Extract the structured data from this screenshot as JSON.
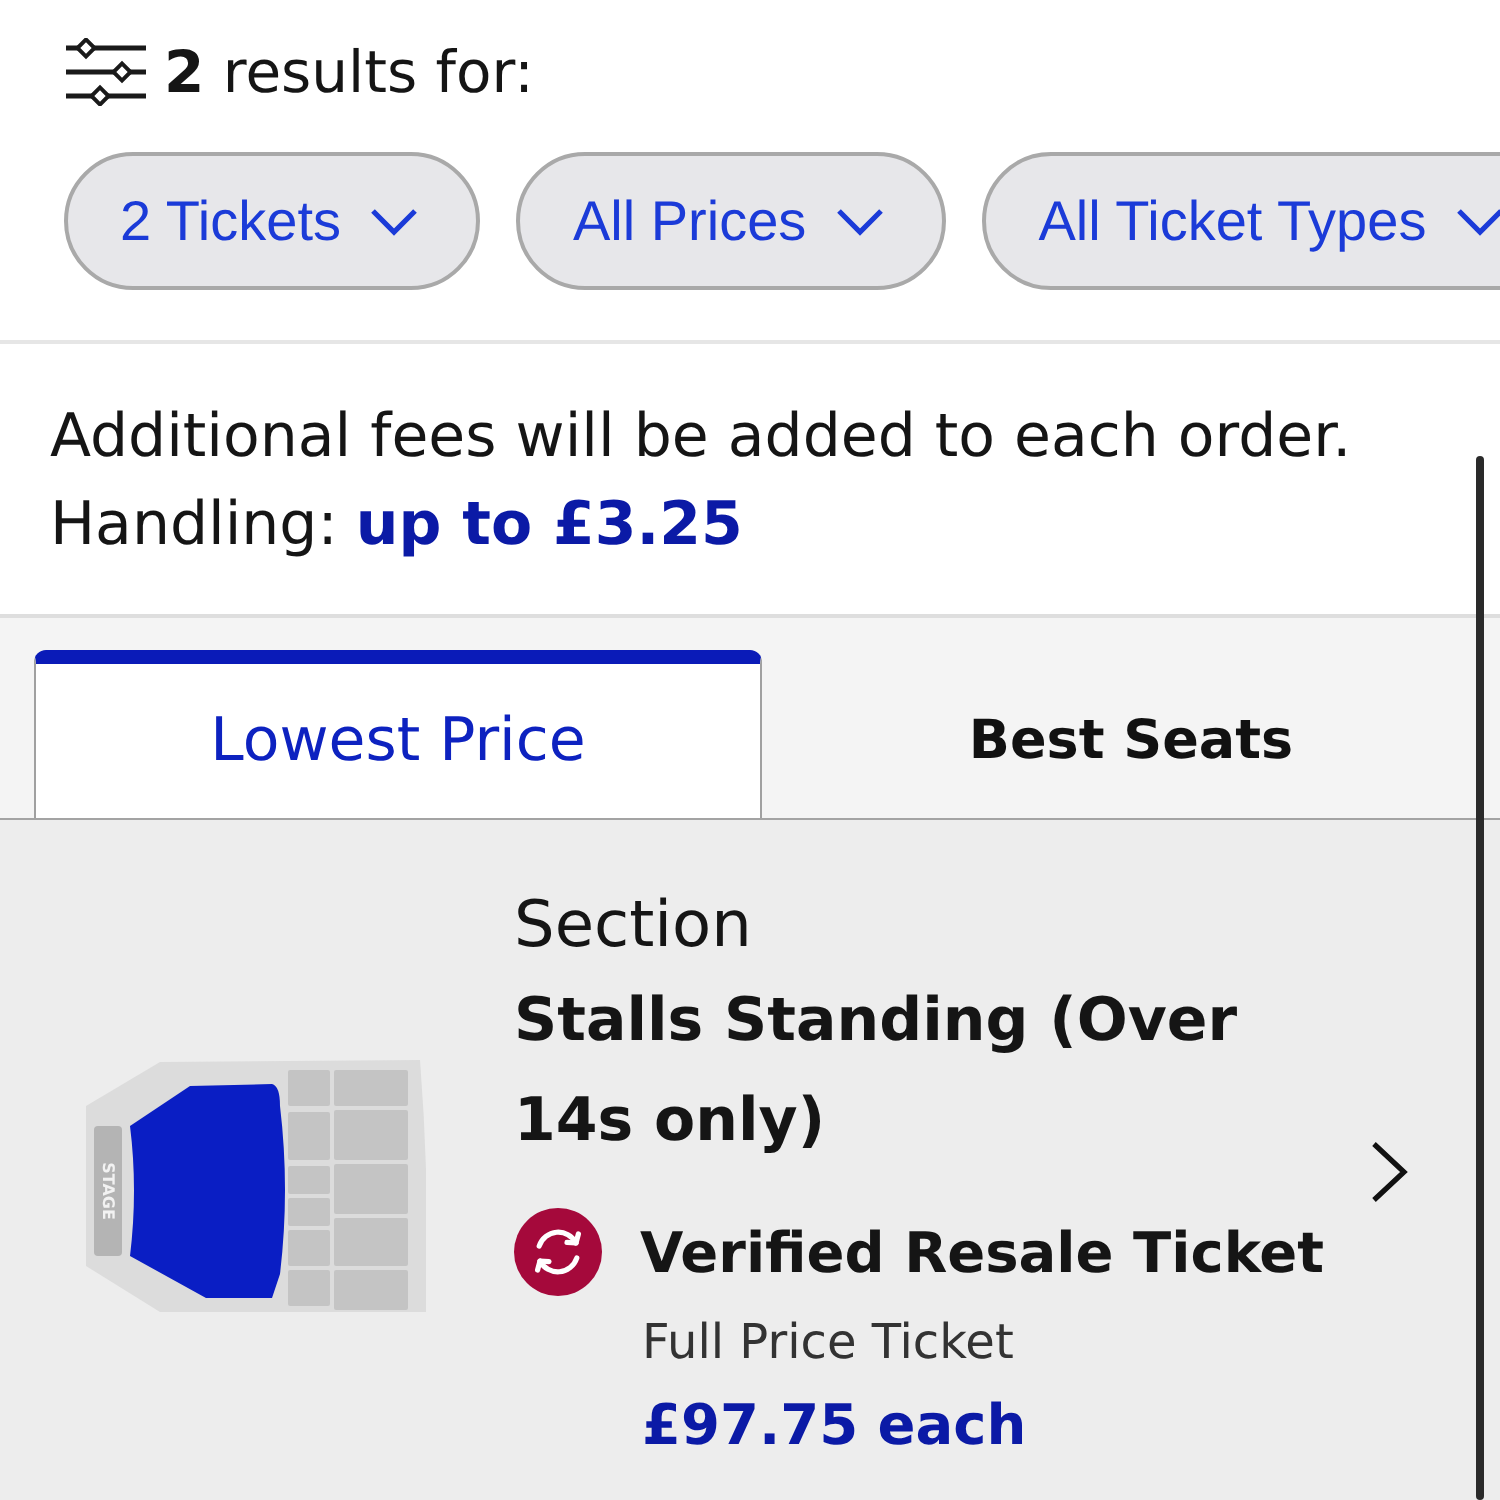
{
  "header": {
    "results_text": "**2** results for:"
  },
  "filters": [
    {
      "label": "2 Tickets"
    },
    {
      "label": "All Prices"
    },
    {
      "label": "All Ticket Types"
    }
  ],
  "fees": {
    "notice": "Additional fees will be added to each order.",
    "handling_label": "Handling:",
    "handling_link": "up to £3.25"
  },
  "sort_tabs": [
    {
      "label": "Lowest Price",
      "selected": true
    },
    {
      "label": "Best Seats",
      "selected": false
    }
  ],
  "listing": {
    "seat_map": {
      "stage_label": "STAGE"
    },
    "section_label": "Section",
    "section_name": "Stalls Standing (Over 14s only)",
    "ticket_type": "Verified Resale Ticket",
    "price_type": "Full Price Ticket",
    "price": "£97.75 each"
  }
}
